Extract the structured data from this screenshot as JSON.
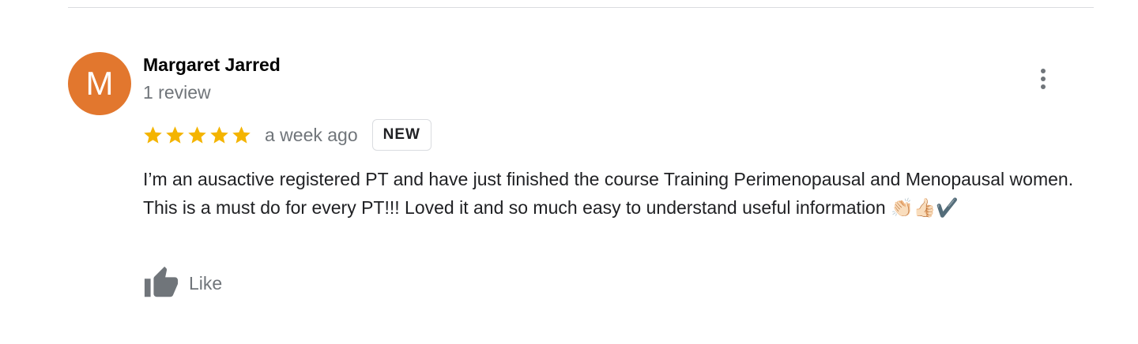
{
  "review": {
    "author": {
      "initial": "M",
      "name": "Margaret Jarred",
      "meta": "1 review",
      "avatar_color": "#e2772e"
    },
    "rating": 5,
    "rating_max": 5,
    "star_color": "#f4b400",
    "date": "a week ago",
    "badge": "NEW",
    "text": "I’m an ausactive registered PT and have just finished the course Training Perimenopausal and Menopausal women. This is a must do for every PT!!! Loved it and so much easy to understand useful information 👏🏻👍🏻✔️",
    "actions": {
      "like_label": "Like",
      "like_icon": "thumb-up-icon",
      "more_icon": "more-vertical-icon"
    }
  }
}
